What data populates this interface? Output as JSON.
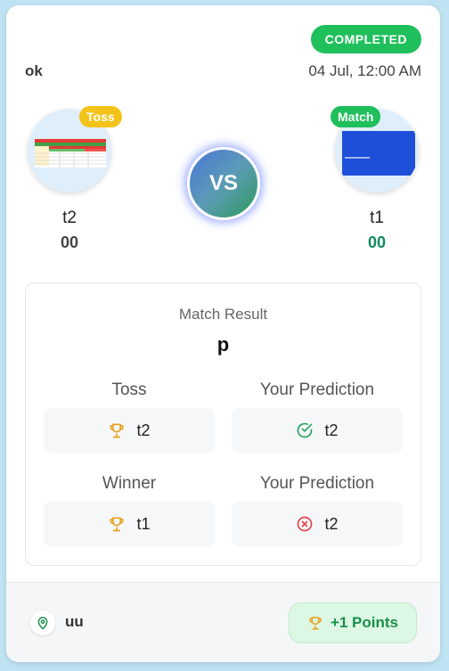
{
  "match": {
    "status": "COMPLETED",
    "name": "ok",
    "date": "04 Jul, 12:00 AM",
    "vs_label": "VS"
  },
  "team_left": {
    "tag": "Toss",
    "name": "t2",
    "score": "00"
  },
  "team_right": {
    "tag": "Match",
    "name": "t1",
    "score": "00"
  },
  "result": {
    "title": "Match Result",
    "value": "p",
    "toss_label": "Toss",
    "toss_value": "t2",
    "toss_prediction_label": "Your Prediction",
    "toss_prediction_value": "t2",
    "toss_prediction_correct": true,
    "winner_label": "Winner",
    "winner_value": "t1",
    "winner_prediction_label": "Your Prediction",
    "winner_prediction_value": "t2",
    "winner_prediction_correct": false
  },
  "footer": {
    "venue": "uu",
    "points": "+1 Points"
  },
  "colors": {
    "status": "#1fbf5b",
    "toss_tag": "#f3c31a",
    "match_tag": "#1fbf5b",
    "trophy": "#e5a11a",
    "correct": "#27a25a",
    "wrong": "#e0434a",
    "points": "#1a8f4c"
  },
  "icons": {
    "trophy": "trophy-icon",
    "correct": "check-circle-icon",
    "wrong": "x-circle-icon",
    "venue": "map-pin-icon"
  }
}
